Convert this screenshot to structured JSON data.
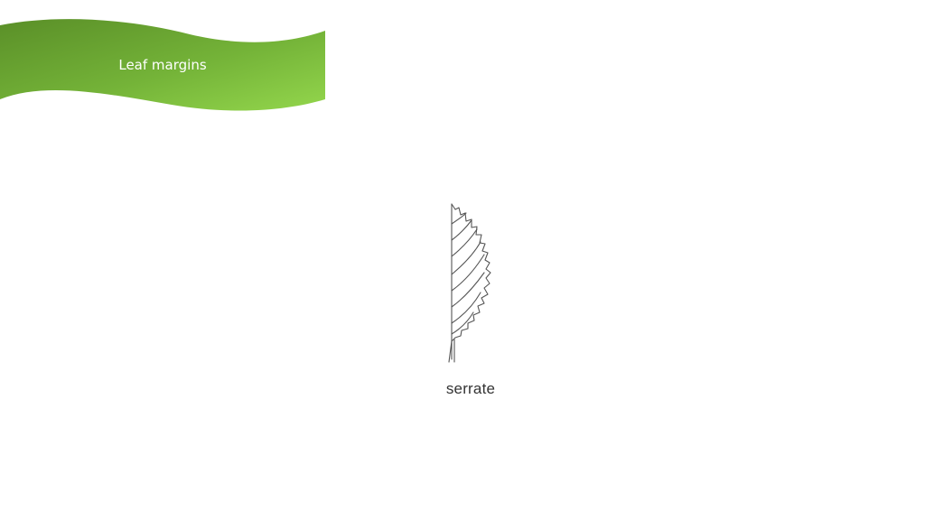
{
  "slide": {
    "title": "Leaf margins",
    "banner_colors": {
      "dark": "#5a8f28",
      "light": "#8fd24a"
    }
  },
  "figure": {
    "icon": "serrate-leaf-icon",
    "caption": "serrate"
  }
}
